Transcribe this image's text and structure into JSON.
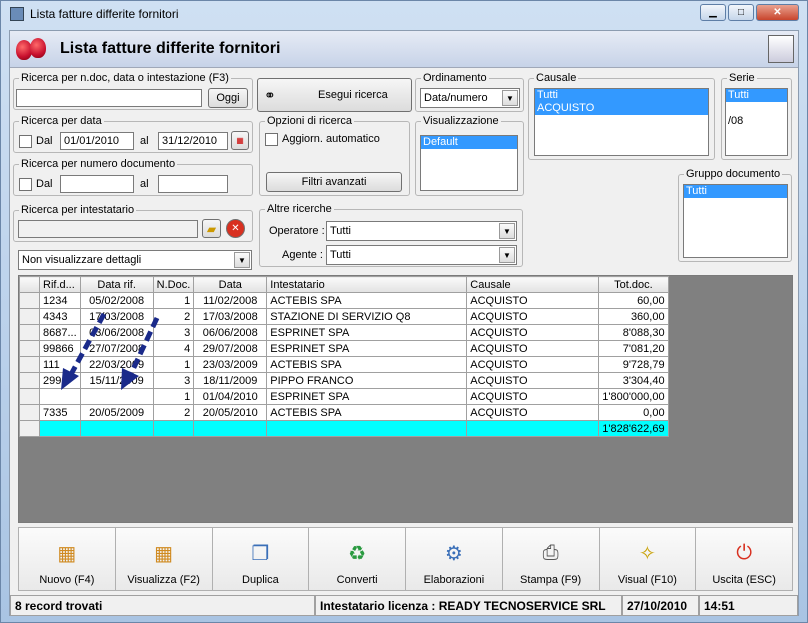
{
  "window": {
    "title": "Lista fatture differite fornitori"
  },
  "header": {
    "title": "Lista fatture differite fornitori"
  },
  "search_text": {
    "legend": "Ricerca per n.doc, data o intestazione (F3)",
    "value": "",
    "button": "Oggi"
  },
  "search_button": {
    "label": "Esegui ricerca"
  },
  "date_search": {
    "legend": "Ricerca per data",
    "dal_label": "Dal",
    "from": "01/01/2010",
    "al_label": "al",
    "to": "31/12/2010"
  },
  "number_search": {
    "legend": "Ricerca per numero documento",
    "dal_label": "Dal",
    "from": "",
    "al_label": "al",
    "to": ""
  },
  "holder_search": {
    "legend": "Ricerca per intestatario",
    "value": ""
  },
  "details_combo": {
    "value": "Non visualizzare dettagli"
  },
  "search_options": {
    "legend": "Opzioni di ricerca",
    "auto_update": "Aggiorn. automatico",
    "advanced_filters": "Filtri avanzati"
  },
  "other_searches": {
    "legend": "Altre ricerche",
    "operator_label": "Operatore :",
    "operator_value": "Tutti",
    "agent_label": "Agente :",
    "agent_value": "Tutti"
  },
  "ordering": {
    "legend": "Ordinamento",
    "value": "Data/numero"
  },
  "view": {
    "legend": "Visualizzazione",
    "items": [
      "Default"
    ]
  },
  "causale": {
    "legend": "Causale",
    "items": [
      "Tutti",
      "ACQUISTO"
    ]
  },
  "serie": {
    "legend": "Serie",
    "items": [
      "Tutti",
      "/08"
    ]
  },
  "doc_group": {
    "legend": "Gruppo documento",
    "items": [
      "Tutti"
    ]
  },
  "table": {
    "headers": [
      "Rif.d...",
      "Data rif.",
      "N.Doc.",
      "Data",
      "Intestatario",
      "Causale",
      "Tot.doc."
    ],
    "rows": [
      [
        "1234",
        "05/02/2008",
        "1",
        "11/02/2008",
        "ACTEBIS SPA",
        "ACQUISTO",
        "60,00"
      ],
      [
        "4343",
        "17/03/2008",
        "2",
        "17/03/2008",
        "STAZIONE DI SERVIZIO Q8",
        "ACQUISTO",
        "360,00"
      ],
      [
        "8687...",
        "03/06/2008",
        "3",
        "06/06/2008",
        "ESPRINET SPA",
        "ACQUISTO",
        "8'088,30"
      ],
      [
        "99866",
        "27/07/2008",
        "4",
        "29/07/2008",
        "ESPRINET SPA",
        "ACQUISTO",
        "7'081,20"
      ],
      [
        "111",
        "22/03/2009",
        "1",
        "23/03/2009",
        "ACTEBIS SPA",
        "ACQUISTO",
        "9'728,79"
      ],
      [
        "299",
        "15/11/2009",
        "3",
        "18/11/2009",
        "PIPPO FRANCO",
        "ACQUISTO",
        "3'304,40"
      ],
      [
        "",
        "",
        "1",
        "01/04/2010",
        "ESPRINET SPA",
        "ACQUISTO",
        "1'800'000,00"
      ],
      [
        "7335",
        "20/05/2009",
        "2",
        "20/05/2010",
        "ACTEBIS SPA",
        "ACQUISTO",
        "0,00"
      ]
    ],
    "total": "1'828'622,69"
  },
  "toolbar": [
    {
      "label": "Nuovo (F4)",
      "icon": "new-grid-icon"
    },
    {
      "label": "Visualizza (F2)",
      "icon": "view-grid-icon"
    },
    {
      "label": "Duplica",
      "icon": "duplicate-icon"
    },
    {
      "label": "Converti",
      "icon": "convert-icon"
    },
    {
      "label": "Elaborazioni",
      "icon": "process-icon"
    },
    {
      "label": "Stampa (F9)",
      "icon": "printer-icon"
    },
    {
      "label": "Visual (F10)",
      "icon": "magic-wand-icon"
    },
    {
      "label": "Uscita (ESC)",
      "icon": "exit-icon"
    }
  ],
  "status": {
    "records": "8 record trovati",
    "license": "Intestatario licenza : READY TECNOSERVICE SRL",
    "date": "27/10/2010",
    "time": "14:51"
  },
  "colors": {
    "selection": "#3399ff",
    "total_row": "#00ffff",
    "arrow": "#1a2a8a"
  }
}
